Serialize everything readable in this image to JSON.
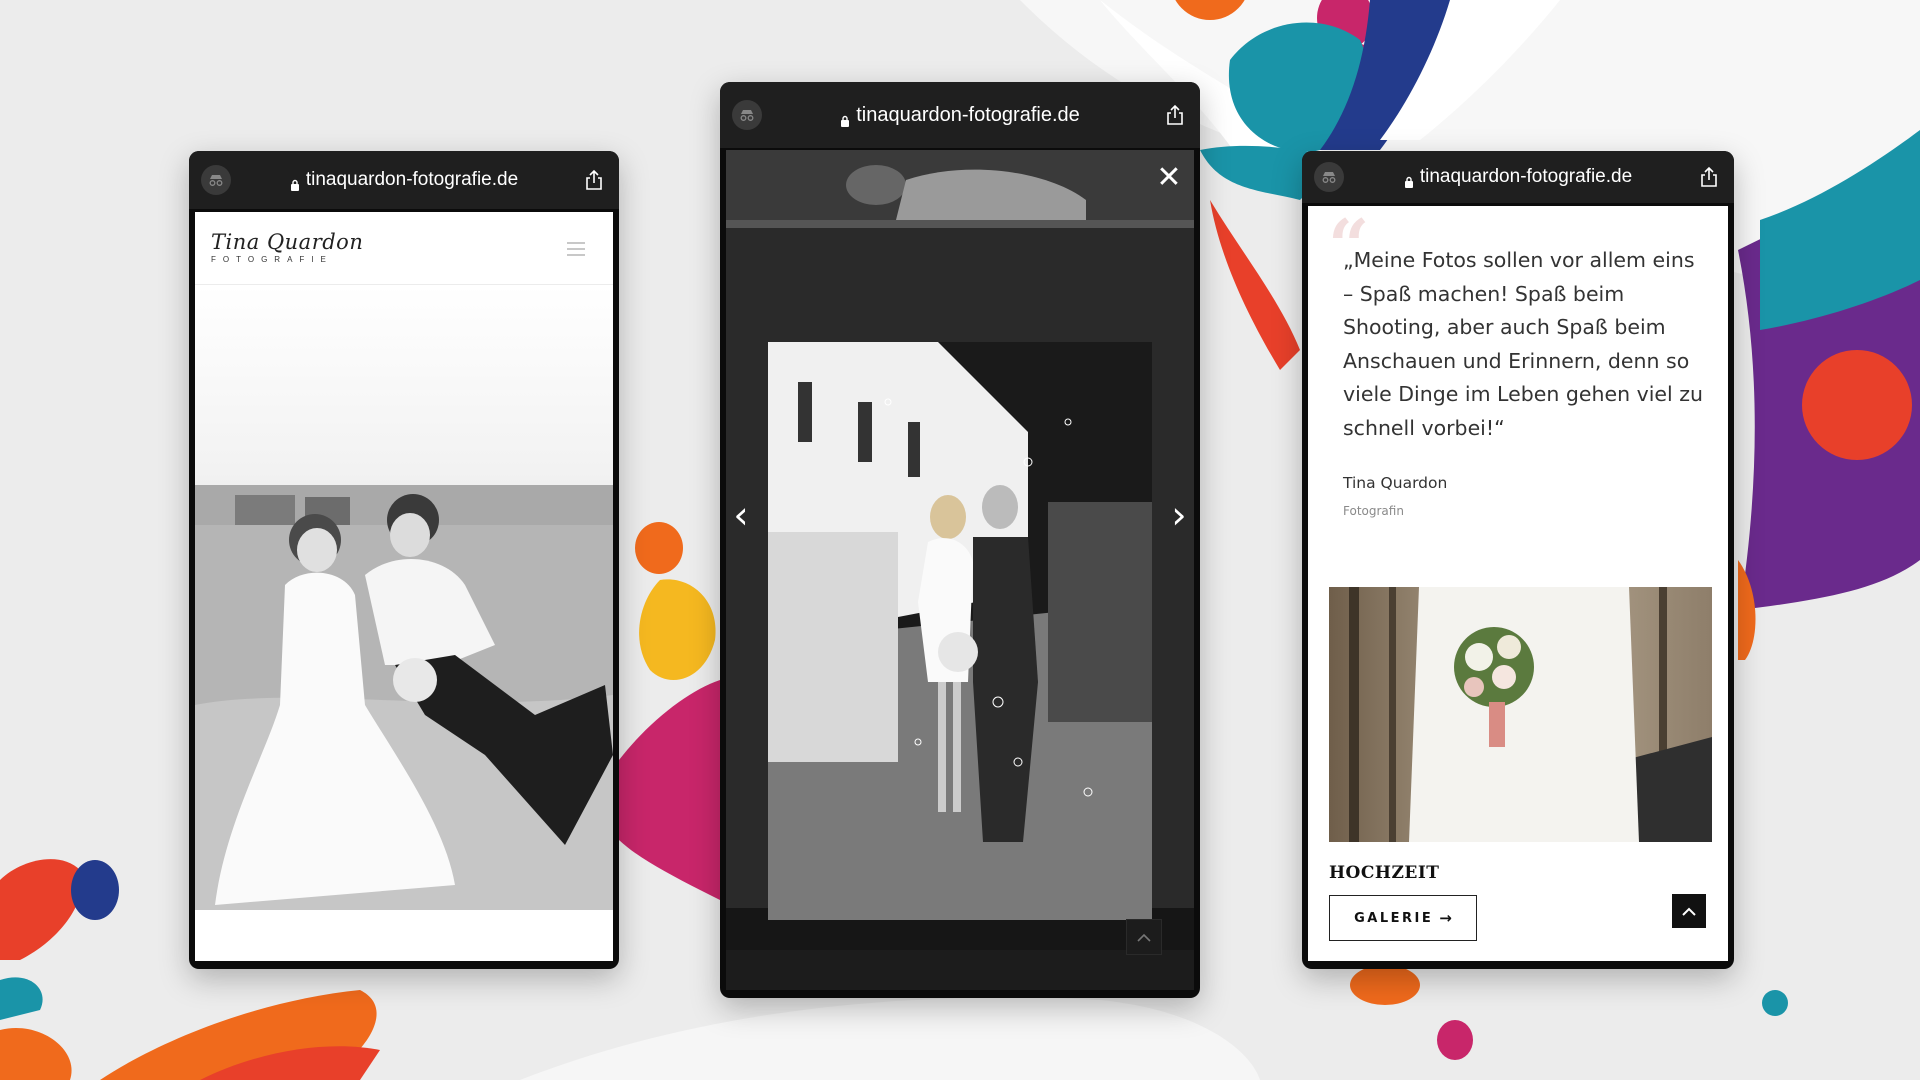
{
  "colors": {
    "background": "#ececec",
    "teal": "#1a94a8",
    "orange": "#f06a1c",
    "red": "#e8402a",
    "magenta": "#c8266a",
    "navy": "#233b8c",
    "yellow": "#f5b820",
    "purple": "#6a2a8c"
  },
  "left_phone": {
    "url": "tinaquardon-fotografie.de",
    "logo_script": "Tina Quardon",
    "logo_sub": "FOTOGRAFIE",
    "icons": [
      "incognito-icon",
      "lock-icon",
      "share-icon",
      "menu-icon"
    ]
  },
  "middle_phone": {
    "url": "tinaquardon-fotografie.de",
    "close_symbol": "✕",
    "prev_symbol": "‹",
    "next_symbol": "›",
    "icons": [
      "incognito-icon",
      "lock-icon",
      "share-icon",
      "close-icon",
      "chevron-left-icon",
      "chevron-right-icon",
      "chevron-up-icon"
    ]
  },
  "right_phone": {
    "url": "tinaquardon-fotografie.de",
    "quote": "„Meine Fotos sollen vor allem eins – Spaß machen! Spaß beim Shooting, aber auch Spaß beim Anschauen und Erinnern, denn so viele Dinge im Leben gehen viel zu schnell vorbei!“",
    "author": "Tina Quardon",
    "role": "Fotografin",
    "card_title": "HOCHZEIT",
    "gallery_button": "GALERIE",
    "icons": [
      "incognito-icon",
      "lock-icon",
      "share-icon",
      "quote-icon",
      "arrow-right-icon",
      "chevron-up-icon"
    ]
  }
}
